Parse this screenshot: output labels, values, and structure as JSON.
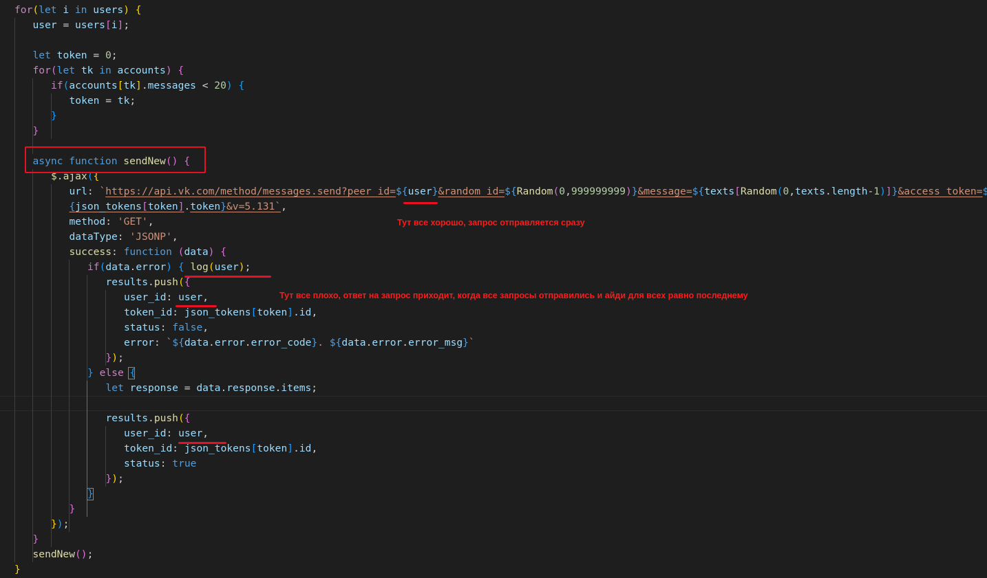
{
  "editor": {
    "lines": [
      [
        [
          "c",
          "for"
        ],
        [
          "b1",
          "("
        ],
        [
          "k",
          "let "
        ],
        [
          "v",
          "i "
        ],
        [
          "k",
          "in "
        ],
        [
          "v",
          "users"
        ],
        [
          "b1",
          ")"
        ],
        [
          "p",
          " "
        ],
        [
          "b1",
          "{"
        ]
      ],
      [
        [
          "v",
          "user"
        ],
        [
          "p",
          " = "
        ],
        [
          "v",
          "users"
        ],
        [
          "b2",
          "["
        ],
        [
          "v",
          "i"
        ],
        [
          "b2",
          "]"
        ],
        [
          "p",
          ";"
        ]
      ],
      [],
      [
        [
          "k",
          "let "
        ],
        [
          "v",
          "token"
        ],
        [
          "p",
          " = "
        ],
        [
          "n",
          "0"
        ],
        [
          "p",
          ";"
        ]
      ],
      [
        [
          "c",
          "for"
        ],
        [
          "b2",
          "("
        ],
        [
          "k",
          "let "
        ],
        [
          "v",
          "tk "
        ],
        [
          "k",
          "in "
        ],
        [
          "v",
          "accounts"
        ],
        [
          "b2",
          ")"
        ],
        [
          "p",
          " "
        ],
        [
          "b2",
          "{"
        ]
      ],
      [
        [
          "c",
          "if"
        ],
        [
          "b3",
          "("
        ],
        [
          "v",
          "accounts"
        ],
        [
          "b1",
          "["
        ],
        [
          "v",
          "tk"
        ],
        [
          "b1",
          "]"
        ],
        [
          "p",
          "."
        ],
        [
          "v",
          "messages"
        ],
        [
          "p",
          " < "
        ],
        [
          "n",
          "20"
        ],
        [
          "b3",
          ")"
        ],
        [
          "p",
          " "
        ],
        [
          "b3",
          "{"
        ]
      ],
      [
        [
          "v",
          "token"
        ],
        [
          "p",
          " = "
        ],
        [
          "v",
          "tk"
        ],
        [
          "p",
          ";"
        ]
      ],
      [
        [
          "b3",
          "}"
        ]
      ],
      [
        [
          "b2",
          "}"
        ]
      ],
      [],
      [
        [
          "k",
          "async "
        ],
        [
          "k",
          "function "
        ],
        [
          "f",
          "sendNew"
        ],
        [
          "b2",
          "()"
        ],
        [
          "p",
          " "
        ],
        [
          "b2",
          "{"
        ]
      ],
      [
        [
          "f",
          "$"
        ],
        [
          "p",
          "."
        ],
        [
          "f",
          "ajax"
        ],
        [
          "b3",
          "("
        ],
        [
          "b1",
          "{"
        ]
      ],
      [
        [
          "v",
          "url"
        ],
        [
          "p",
          ": "
        ],
        [
          "s",
          "`"
        ],
        [
          "s",
          "https://api.vk.com/method/messages.send?peer_id="
        ],
        [
          "k",
          "${"
        ],
        [
          "v",
          "user"
        ],
        [
          "k",
          "}"
        ],
        [
          "s",
          "&random_id="
        ],
        [
          "k",
          "${"
        ],
        [
          "f",
          "Random"
        ],
        [
          "b2",
          "("
        ],
        [
          "n",
          "0"
        ],
        [
          "p",
          ","
        ],
        [
          "n",
          "999999999"
        ],
        [
          "b2",
          ")"
        ],
        [
          "k",
          "}"
        ],
        [
          "s",
          "&message="
        ],
        [
          "k",
          "${"
        ],
        [
          "v",
          "texts"
        ],
        [
          "b2",
          "["
        ],
        [
          "f",
          "Random"
        ],
        [
          "b3",
          "("
        ],
        [
          "n",
          "0"
        ],
        [
          "p",
          ","
        ],
        [
          "v",
          "texts"
        ],
        [
          "p",
          "."
        ],
        [
          "v",
          "length"
        ],
        [
          "p",
          "-"
        ],
        [
          "n",
          "1"
        ],
        [
          "b3",
          ")"
        ],
        [
          "b2",
          "]"
        ],
        [
          "k",
          "}"
        ],
        [
          "s",
          "&access_token="
        ],
        [
          "k",
          "$"
        ]
      ],
      [
        [
          "k",
          "{"
        ],
        [
          "v",
          "json_tokens"
        ],
        [
          "b2",
          "["
        ],
        [
          "v",
          "token"
        ],
        [
          "b2",
          "]"
        ],
        [
          "p",
          "."
        ],
        [
          "v",
          "token"
        ],
        [
          "k",
          "}"
        ],
        [
          "s",
          "&v=5.131"
        ],
        [
          "s",
          "`"
        ],
        [
          "p",
          ","
        ]
      ],
      [
        [
          "v",
          "method"
        ],
        [
          "p",
          ": "
        ],
        [
          "s",
          "'GET'"
        ],
        [
          "p",
          ","
        ]
      ],
      [
        [
          "v",
          "dataType"
        ],
        [
          "p",
          ": "
        ],
        [
          "s",
          "'JSONP'"
        ],
        [
          "p",
          ","
        ]
      ],
      [
        [
          "f",
          "success"
        ],
        [
          "p",
          ": "
        ],
        [
          "k",
          "function "
        ],
        [
          "b2",
          "("
        ],
        [
          "v",
          "data"
        ],
        [
          "b2",
          ")"
        ],
        [
          "p",
          " "
        ],
        [
          "b2",
          "{"
        ]
      ],
      [
        [
          "c",
          "if"
        ],
        [
          "b3",
          "("
        ],
        [
          "v",
          "data"
        ],
        [
          "p",
          "."
        ],
        [
          "v",
          "error"
        ],
        [
          "b3",
          ")"
        ],
        [
          "p",
          " "
        ],
        [
          "b3",
          "{"
        ],
        [
          "p",
          " "
        ],
        [
          "f",
          "log"
        ],
        [
          "b1",
          "("
        ],
        [
          "v",
          "user"
        ],
        [
          "b1",
          ")"
        ],
        [
          "p",
          ";"
        ]
      ],
      [
        [
          "v",
          "results"
        ],
        [
          "p",
          "."
        ],
        [
          "f",
          "push"
        ],
        [
          "b1",
          "("
        ],
        [
          "b2",
          "{"
        ]
      ],
      [
        [
          "v",
          "user_id"
        ],
        [
          "p",
          ": "
        ],
        [
          "v",
          "user"
        ],
        [
          "p",
          ","
        ]
      ],
      [
        [
          "v",
          "token_id"
        ],
        [
          "p",
          ": "
        ],
        [
          "v",
          "json_tokens"
        ],
        [
          "b3",
          "["
        ],
        [
          "v",
          "token"
        ],
        [
          "b3",
          "]"
        ],
        [
          "p",
          "."
        ],
        [
          "v",
          "id"
        ],
        [
          "p",
          ","
        ]
      ],
      [
        [
          "v",
          "status"
        ],
        [
          "p",
          ": "
        ],
        [
          "k",
          "false"
        ],
        [
          "p",
          ","
        ]
      ],
      [
        [
          "v",
          "error"
        ],
        [
          "p",
          ": "
        ],
        [
          "s",
          "`"
        ],
        [
          "k",
          "${"
        ],
        [
          "v",
          "data"
        ],
        [
          "p",
          "."
        ],
        [
          "v",
          "error"
        ],
        [
          "p",
          "."
        ],
        [
          "v",
          "error_code"
        ],
        [
          "k",
          "}"
        ],
        [
          "s",
          ". "
        ],
        [
          "k",
          "${"
        ],
        [
          "v",
          "data"
        ],
        [
          "p",
          "."
        ],
        [
          "v",
          "error"
        ],
        [
          "p",
          "."
        ],
        [
          "v",
          "error_msg"
        ],
        [
          "k",
          "}"
        ],
        [
          "s",
          "`"
        ]
      ],
      [
        [
          "b2",
          "}"
        ],
        [
          "b1",
          ")"
        ],
        [
          "p",
          ";"
        ]
      ],
      [
        [
          "b3",
          "}"
        ],
        [
          "p",
          " "
        ],
        [
          "c",
          "else "
        ],
        [
          "b3",
          "{"
        ]
      ],
      [
        [
          "k",
          "let "
        ],
        [
          "v",
          "response"
        ],
        [
          "p",
          " = "
        ],
        [
          "v",
          "data"
        ],
        [
          "p",
          "."
        ],
        [
          "v",
          "response"
        ],
        [
          "p",
          "."
        ],
        [
          "v",
          "items"
        ],
        [
          "p",
          ";"
        ]
      ],
      [],
      [
        [
          "v",
          "results"
        ],
        [
          "p",
          "."
        ],
        [
          "f",
          "push"
        ],
        [
          "b1",
          "("
        ],
        [
          "b2",
          "{"
        ]
      ],
      [
        [
          "v",
          "user_id"
        ],
        [
          "p",
          ": "
        ],
        [
          "v",
          "user"
        ],
        [
          "p",
          ","
        ]
      ],
      [
        [
          "v",
          "token_id"
        ],
        [
          "p",
          ": "
        ],
        [
          "v",
          "json_tokens"
        ],
        [
          "b3",
          "["
        ],
        [
          "v",
          "token"
        ],
        [
          "b3",
          "]"
        ],
        [
          "p",
          "."
        ],
        [
          "v",
          "id"
        ],
        [
          "p",
          ","
        ]
      ],
      [
        [
          "v",
          "status"
        ],
        [
          "p",
          ": "
        ],
        [
          "k",
          "true"
        ]
      ],
      [
        [
          "b2",
          "}"
        ],
        [
          "b1",
          ")"
        ],
        [
          "p",
          ";"
        ]
      ],
      [
        [
          "b3",
          "}"
        ]
      ],
      [
        [
          "b2",
          "}"
        ]
      ],
      [
        [
          "b1",
          "}"
        ],
        [
          "b3",
          ")"
        ],
        [
          "p",
          ";"
        ]
      ],
      [
        [
          "b2",
          "}"
        ]
      ],
      [
        [
          "f",
          "sendNew"
        ],
        [
          "b2",
          "()"
        ],
        [
          "p",
          ";"
        ]
      ],
      [
        [
          "b1",
          "}"
        ]
      ]
    ]
  },
  "annotations": {
    "note_request_ok": "Тут все хорошо, запрос отправляется сразу",
    "note_request_bad": "Тут все плохо, ответ на запрос приходит, когда все запросы отправились и айди для всех равно последнему"
  },
  "colors": {
    "background": "#1e1e1e",
    "annotation_red": "#e81123"
  }
}
